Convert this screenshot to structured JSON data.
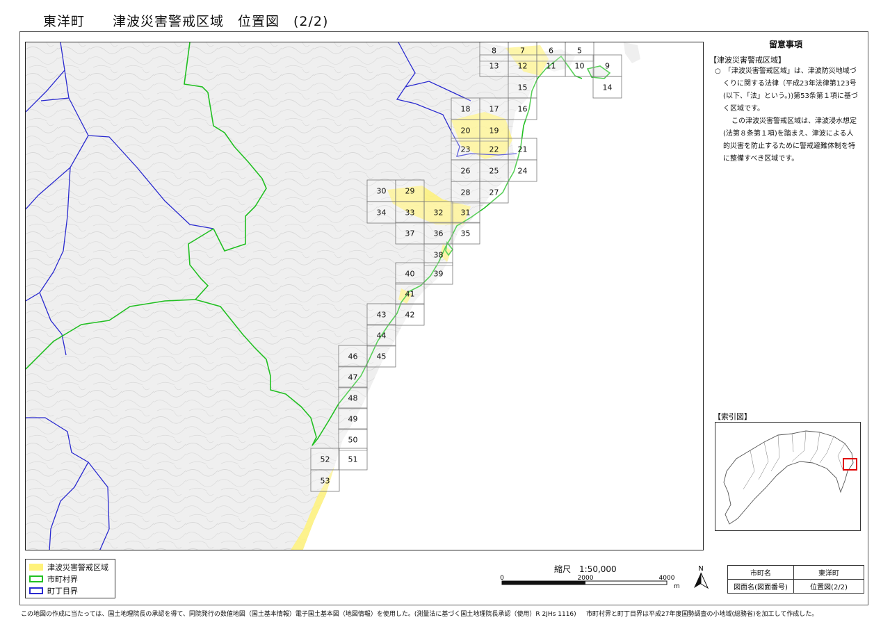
{
  "title": "東洋町　　津波災害警戒区域　位置図　(2/2)",
  "notes": {
    "title": "留意事項",
    "heading": "【津波災害警戒区域】",
    "paragraph1": "○　「津波災害警戒区域」は、津波防災地域づくりに関する法律（平成23年法律第123号(以下、「法」という。))第53条第１項に基づく区域です。",
    "paragraph2": "この津波災害警戒区域は、津波浸水想定(法第８条第１項)を踏まえ、津波による人的災害を防止するために警戒避難体制を特に整備すべき区域です。"
  },
  "index_map": {
    "heading": "【索引図】"
  },
  "legend": [
    {
      "label": "津波災害警戒区域",
      "color": "#fff27a",
      "kind": "fill"
    },
    {
      "label": "市町村界",
      "color": "#22c022",
      "kind": "border"
    },
    {
      "label": "町丁目界",
      "color": "#2a2ad0",
      "kind": "border"
    }
  ],
  "scale": {
    "title": "縮尺　1:50,000",
    "ticks": [
      "0",
      "2000",
      "4000"
    ],
    "unit": "m"
  },
  "north": {
    "label": "N"
  },
  "info_table": {
    "row1": {
      "key": "市町名",
      "value": "東洋町"
    },
    "row2": {
      "key": "図面名(図面番号)",
      "value": "位置図(2/2)"
    }
  },
  "footer": {
    "left": "この地図の作成に当たっては、国土地理院長の承認を得て、同院発行の数値地図（国土基本情報）電子国土基本図（地図情報）を使用した。(測量法に基づく国土地理院長承認（使用）R 2JHs 1116)",
    "right": "市町村界と町丁目界は平成27年度国勢調査の小地域(総務省)を加工して作成した。"
  },
  "colors": {
    "zone": "#fff27a",
    "municipal_border": "#22c022",
    "district_border": "#2a2ad0",
    "index_highlight": "#e00000"
  },
  "sheets": [
    "5",
    "6",
    "7",
    "8",
    "9",
    "10",
    "11",
    "12",
    "13",
    "14",
    "15",
    "16",
    "17",
    "18",
    "19",
    "20",
    "21",
    "22",
    "23",
    "24",
    "25",
    "26",
    "27",
    "28",
    "29",
    "30",
    "31",
    "32",
    "33",
    "34",
    "35",
    "36",
    "37",
    "38",
    "39",
    "40",
    "41",
    "42",
    "43",
    "44",
    "45",
    "46",
    "47",
    "48",
    "49",
    "50",
    "51",
    "52",
    "53"
  ]
}
